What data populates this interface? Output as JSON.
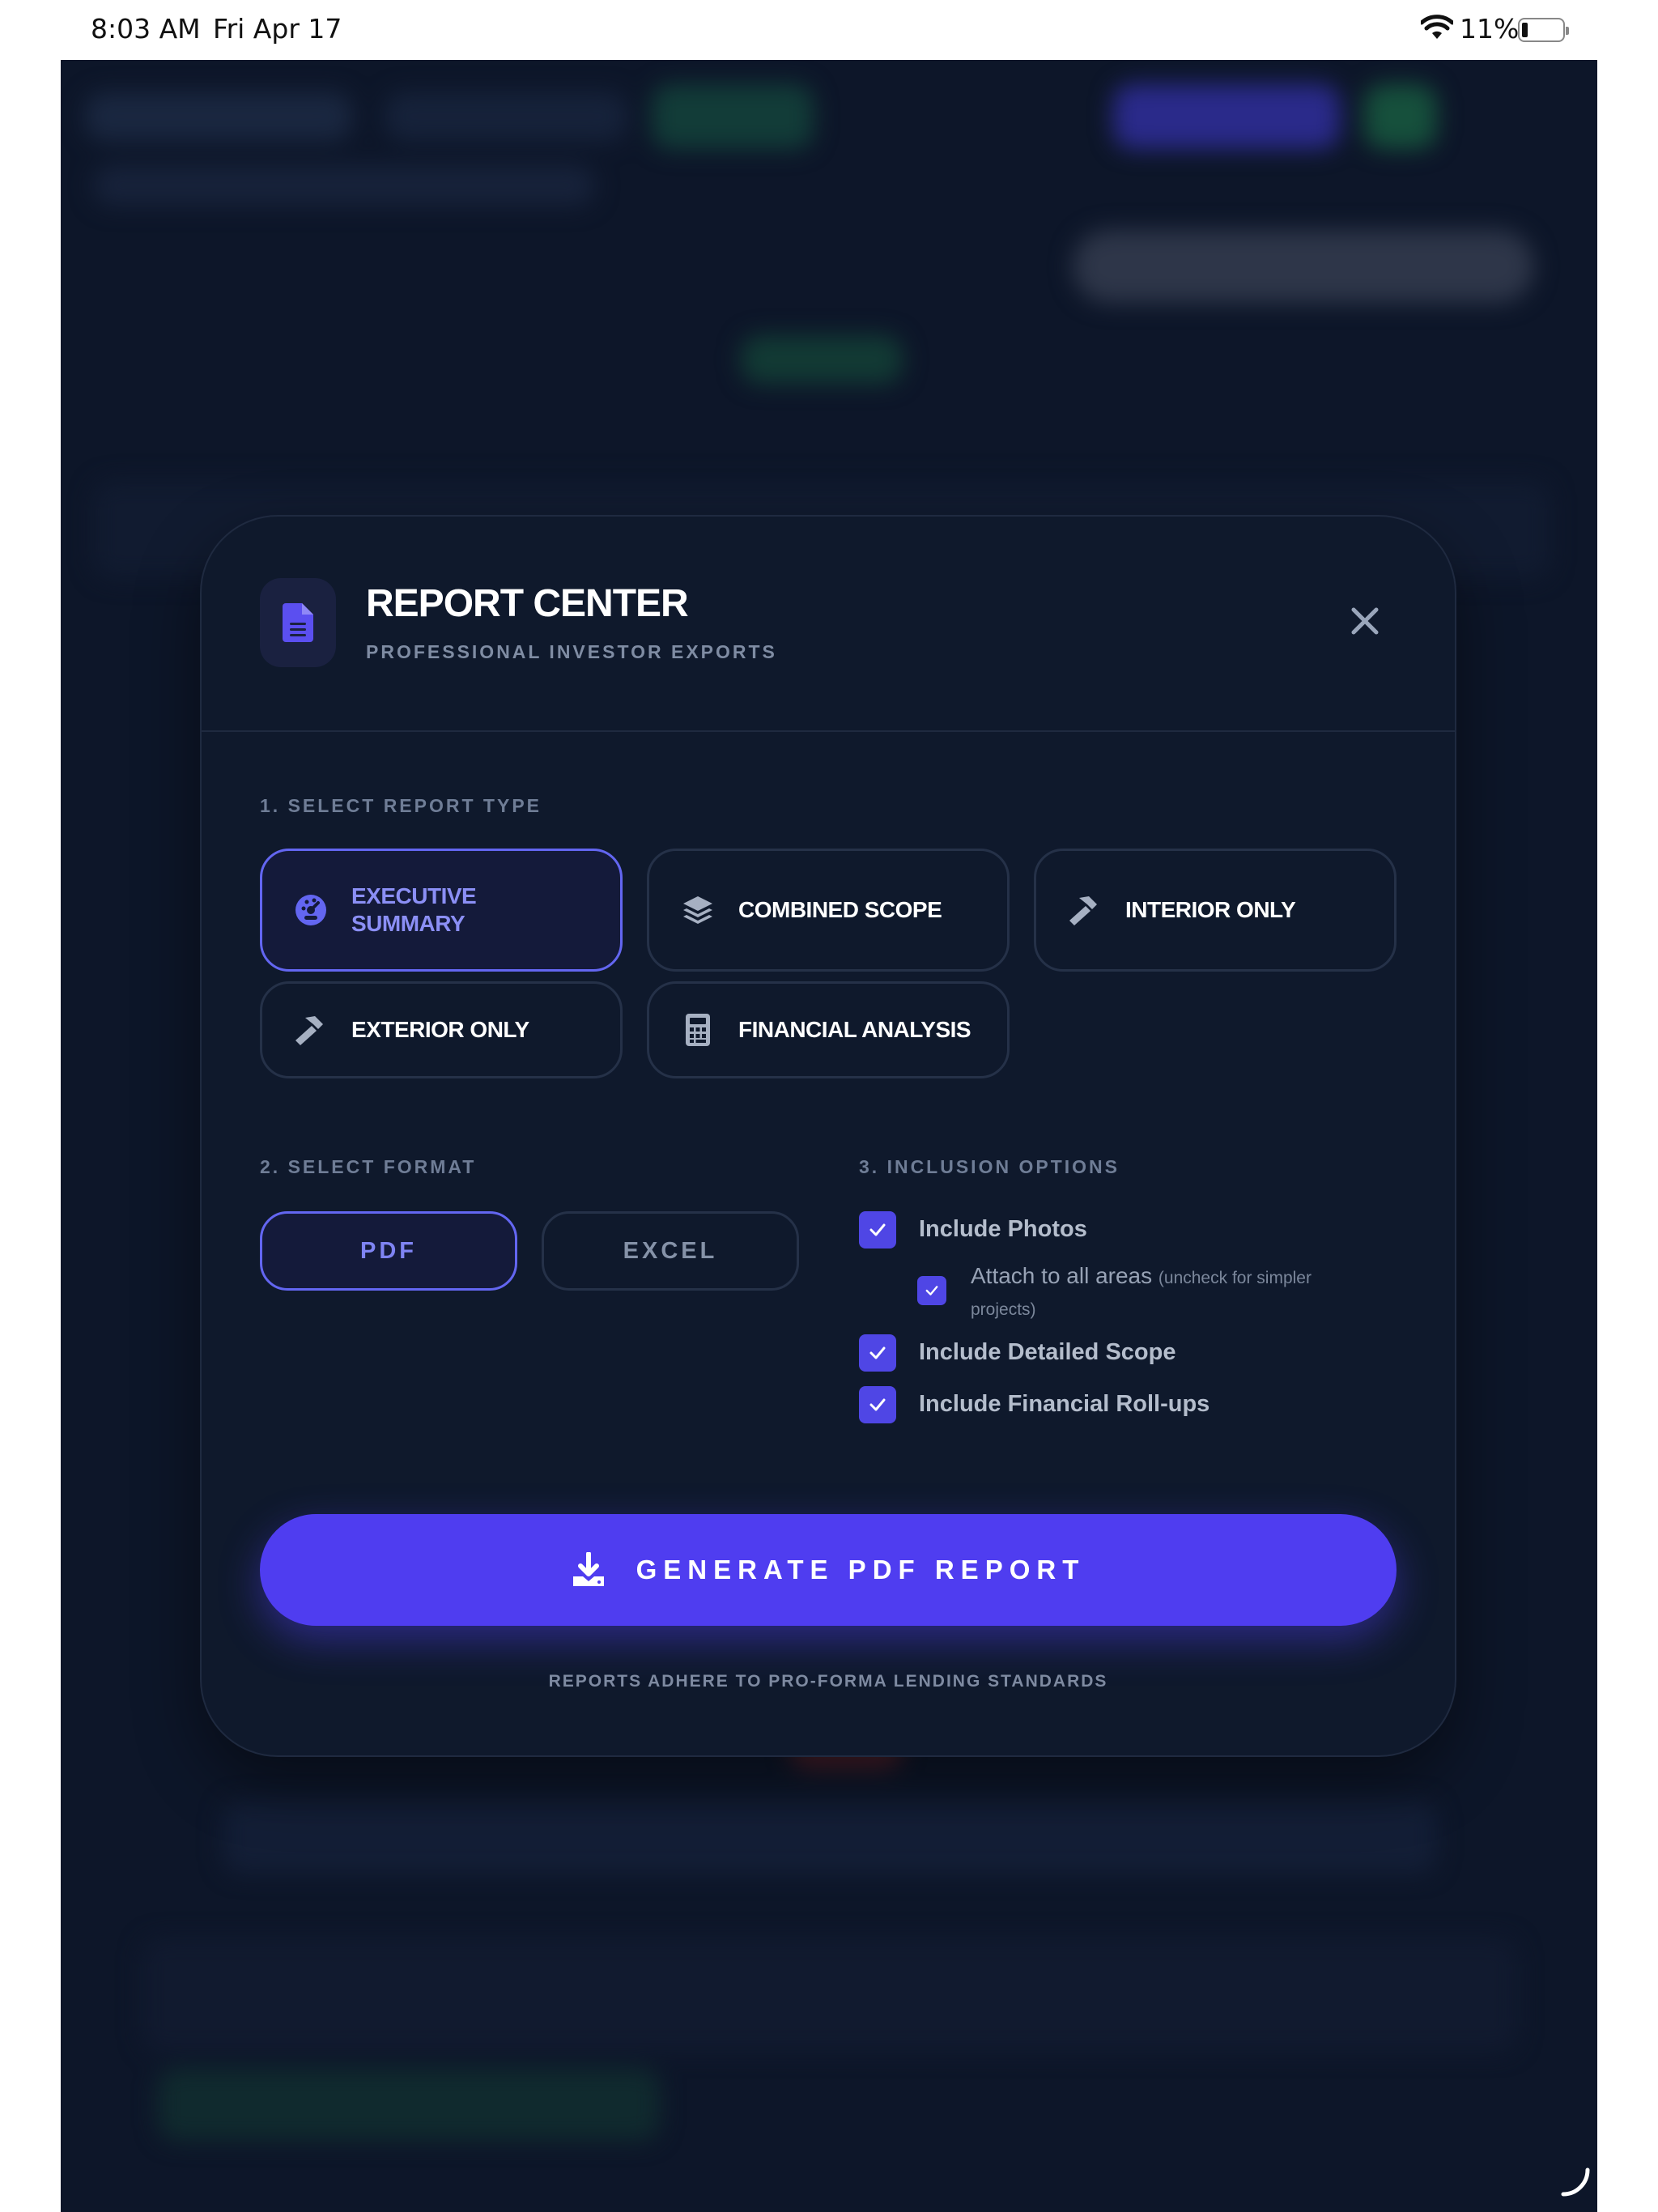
{
  "status_bar": {
    "time": "8:03 AM",
    "date": "Fri Apr 17",
    "battery": "11%"
  },
  "modal": {
    "title": "REPORT CENTER",
    "subtitle": "PROFESSIONAL INVESTOR EXPORTS",
    "header_icon": "document-icon",
    "close_icon": "close-icon"
  },
  "report_type": {
    "label": "1. SELECT REPORT TYPE",
    "options": [
      {
        "label": "EXECUTIVE SUMMARY",
        "icon": "dashboard-gauge-icon",
        "selected": true
      },
      {
        "label": "COMBINED SCOPE",
        "icon": "layers-icon",
        "selected": false
      },
      {
        "label": "INTERIOR ONLY",
        "icon": "hammer-icon",
        "selected": false
      },
      {
        "label": "EXTERIOR ONLY",
        "icon": "hammer-icon",
        "selected": false
      },
      {
        "label": "FINANCIAL ANALYSIS",
        "icon": "calculator-icon",
        "selected": false
      }
    ]
  },
  "format": {
    "label": "2. SELECT FORMAT",
    "options": [
      {
        "label": "PDF",
        "selected": true
      },
      {
        "label": "EXCEL",
        "selected": false
      }
    ]
  },
  "inclusion": {
    "label": "3. INCLUSION OPTIONS",
    "include_photos": {
      "label": "Include Photos",
      "checked": true
    },
    "attach_all": {
      "label": "Attach to all areas",
      "hint": "(uncheck for simpler projects)",
      "checked": true
    },
    "detailed_scope": {
      "label": "Include Detailed Scope",
      "checked": true
    },
    "financial_rollups": {
      "label": "Include Financial Roll-ups",
      "checked": true
    }
  },
  "generate": {
    "label": "GENERATE PDF REPORT",
    "icon": "download-icon"
  },
  "footnote": "REPORTS ADHERE TO PRO-FORMA LENDING STANDARDS",
  "colors": {
    "background": "#0d1629",
    "modal": "#0f192c",
    "accent": "#6366f1",
    "button": "#4f3df0"
  }
}
